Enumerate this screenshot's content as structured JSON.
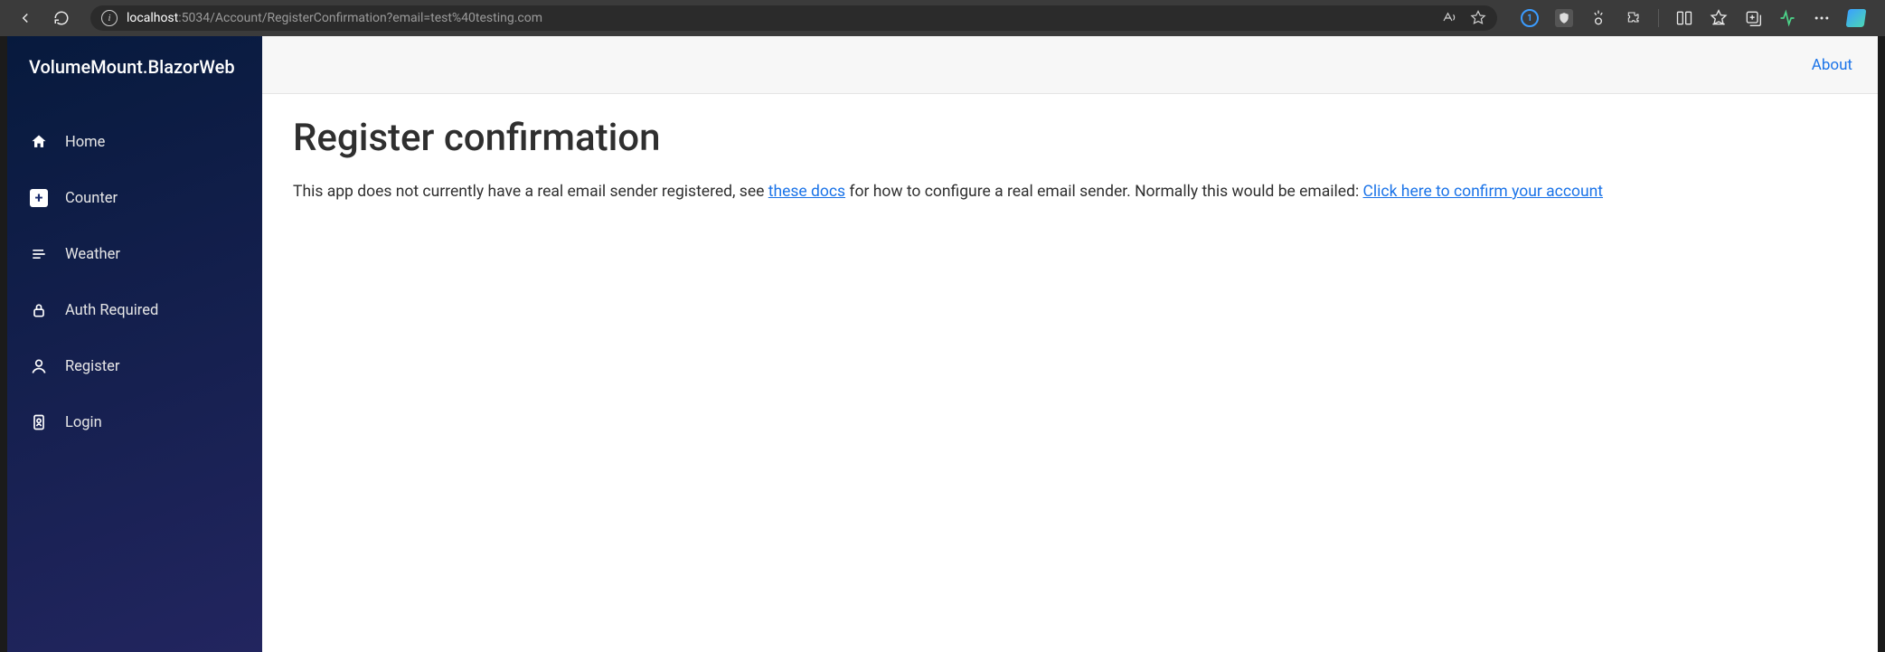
{
  "browser": {
    "url_host": "localhost",
    "url_path": ":5034/Account/RegisterConfirmation?email=test%40testing.com"
  },
  "app": {
    "brand": "VolumeMount.BlazorWeb",
    "topbar": {
      "about_label": "About"
    },
    "sidebar": {
      "items": [
        {
          "label": "Home",
          "icon": "home-icon"
        },
        {
          "label": "Counter",
          "icon": "plus-icon"
        },
        {
          "label": "Weather",
          "icon": "list-icon"
        },
        {
          "label": "Auth Required",
          "icon": "lock-icon"
        },
        {
          "label": "Register",
          "icon": "person-icon"
        },
        {
          "label": "Login",
          "icon": "badge-icon"
        }
      ]
    },
    "page": {
      "title": "Register confirmation",
      "body_pre": "This app does not currently have a real email sender registered, see ",
      "link1_text": "these docs",
      "body_mid": " for how to configure a real email sender. Normally this would be emailed: ",
      "link2_text": "Click here to confirm your account"
    }
  }
}
